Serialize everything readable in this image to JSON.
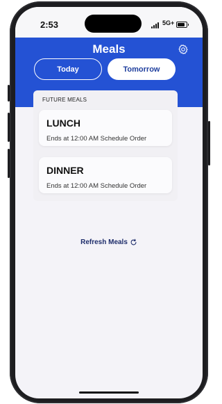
{
  "status_bar": {
    "time": "2:53",
    "network": "5G+",
    "signal_icon": "cellular-signal-icon",
    "battery_icon": "battery-icon"
  },
  "header": {
    "title": "Meals",
    "settings_icon": "gear-icon",
    "background_color": "#2452d4"
  },
  "tabs": [
    {
      "label": "Today",
      "selected": false
    },
    {
      "label": "Tomorrow",
      "selected": true
    }
  ],
  "future_meals": {
    "section_label": "FUTURE MEALS",
    "meals": [
      {
        "name": "LUNCH",
        "detail": "Ends at 12:00 AM Schedule Order"
      },
      {
        "name": "DINNER",
        "detail": "Ends at 12:00 AM Schedule Order"
      }
    ]
  },
  "refresh": {
    "label": "Refresh Meals",
    "icon": "refresh-icon"
  }
}
